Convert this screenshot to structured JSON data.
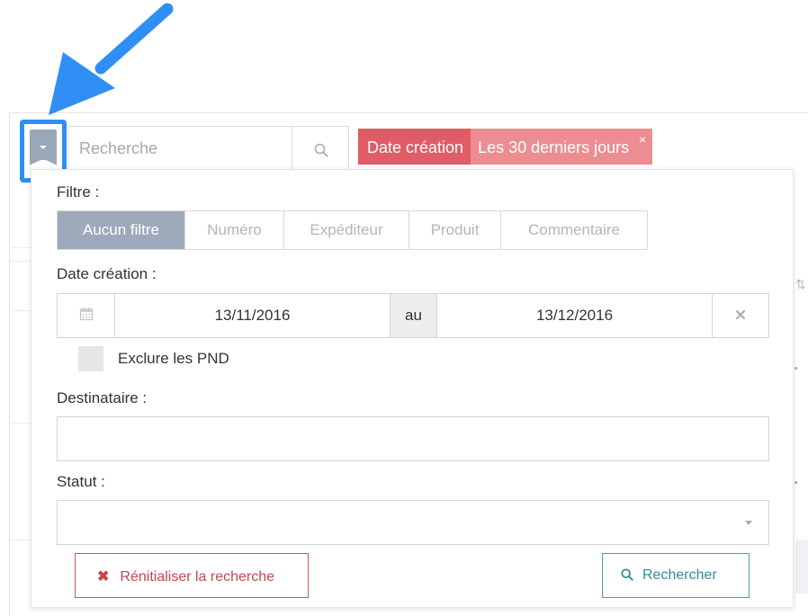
{
  "search": {
    "placeholder": "Recherche"
  },
  "active_filter": {
    "key": "Date création",
    "value": "Les 30 derniers jours",
    "close": "×"
  },
  "panel": {
    "filter_label": "Filtre :",
    "tabs": [
      {
        "label": "Aucun filtre",
        "active": true
      },
      {
        "label": "Numéro"
      },
      {
        "label": "Expéditeur"
      },
      {
        "label": "Produit"
      },
      {
        "label": "Commentaire"
      }
    ],
    "date_label": "Date création :",
    "date_from": "13/11/2016",
    "date_sep": "au",
    "date_to": "13/12/2016",
    "exclude_pnd": "Exclure les PND",
    "recipient_label": "Destinataire :",
    "status_label": "Statut :",
    "reset_label": "Rénitialiser la recherche",
    "submit_label": "Rechercher"
  },
  "colors": {
    "accent_blue": "#2f8ff4",
    "chip_key": "#e05c66",
    "chip_value": "#ec8e91",
    "tab_active": "#9ea9bb",
    "danger": "#d9534f",
    "teal": "#3ba6a6"
  }
}
